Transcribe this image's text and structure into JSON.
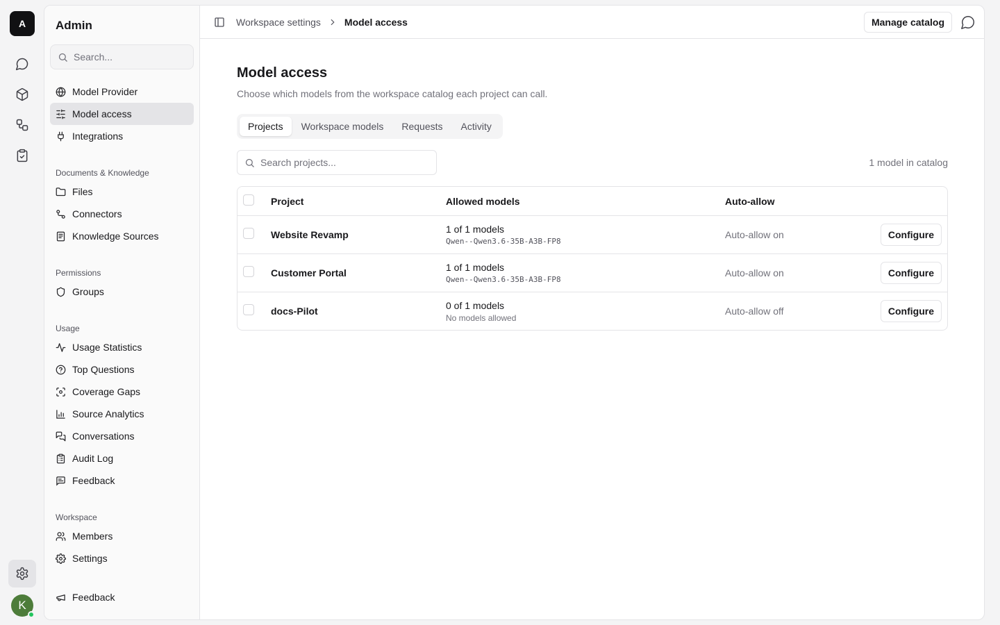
{
  "rail": {
    "logo": "A",
    "avatar_initial": "K"
  },
  "sidebar": {
    "title": "Admin",
    "search_placeholder": "Search...",
    "items_top": [
      {
        "label": "Model Provider",
        "icon": "globe-icon"
      },
      {
        "label": "Model access",
        "icon": "sliders-icon",
        "active": true
      },
      {
        "label": "Integrations",
        "icon": "plug-icon"
      }
    ],
    "groups": [
      {
        "label": "Documents & Knowledge",
        "items": [
          {
            "label": "Files",
            "icon": "folder-icon"
          },
          {
            "label": "Connectors",
            "icon": "connectors-icon"
          },
          {
            "label": "Knowledge Sources",
            "icon": "book-icon"
          }
        ]
      },
      {
        "label": "Permissions",
        "items": [
          {
            "label": "Groups",
            "icon": "shield-icon"
          }
        ]
      },
      {
        "label": "Usage",
        "items": [
          {
            "label": "Usage Statistics",
            "icon": "activity-icon"
          },
          {
            "label": "Top Questions",
            "icon": "help-circle-icon"
          },
          {
            "label": "Coverage Gaps",
            "icon": "scan-icon"
          },
          {
            "label": "Source Analytics",
            "icon": "bar-chart-icon"
          },
          {
            "label": "Conversations",
            "icon": "messages-icon"
          },
          {
            "label": "Audit Log",
            "icon": "clipboard-icon"
          },
          {
            "label": "Feedback",
            "icon": "message-square-text-icon"
          }
        ]
      },
      {
        "label": "Workspace",
        "items": [
          {
            "label": "Members",
            "icon": "users-icon"
          },
          {
            "label": "Settings",
            "icon": "gear-icon"
          }
        ]
      }
    ],
    "footer_label": "Feedback"
  },
  "topbar": {
    "breadcrumb_parent": "Workspace settings",
    "breadcrumb_current": "Model access",
    "manage_catalog_label": "Manage catalog"
  },
  "page": {
    "title": "Model access",
    "subtitle": "Choose which models from the workspace catalog each project can call.",
    "tabs": [
      "Projects",
      "Workspace models",
      "Requests",
      "Activity"
    ],
    "active_tab": "Projects",
    "search_placeholder": "Search projects...",
    "catalog_count": "1 model in catalog"
  },
  "table": {
    "columns": {
      "project": "Project",
      "allowed_models": "Allowed models",
      "auto_allow": "Auto-allow"
    },
    "rows": [
      {
        "project": "Website Revamp",
        "models_count": "1 of 1 models",
        "models_detail": "Qwen--Qwen3.6-35B-A3B-FP8",
        "auto_allow": "Auto-allow on",
        "action": "Configure"
      },
      {
        "project": "Customer Portal",
        "models_count": "1 of 1 models",
        "models_detail": "Qwen--Qwen3.6-35B-A3B-FP8",
        "auto_allow": "Auto-allow on",
        "action": "Configure"
      },
      {
        "project": "docs-Pilot",
        "models_count": "0 of 1 models",
        "models_detail": "No models allowed",
        "auto_allow": "Auto-allow off",
        "action": "Configure"
      }
    ]
  }
}
